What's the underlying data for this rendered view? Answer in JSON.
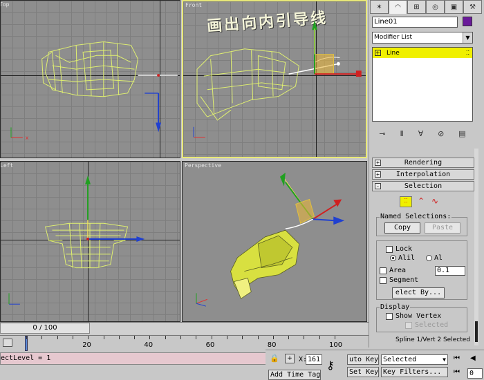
{
  "viewports": {
    "top": {
      "label": "Top"
    },
    "front": {
      "label": "Front",
      "annotation": "画出向内引导线"
    },
    "left": {
      "label": "Left"
    },
    "perspective": {
      "label": "Perspective"
    }
  },
  "panel": {
    "object_name": "Line01",
    "object_color": "#6a1a9a",
    "modifier_list": "Modifier List",
    "stack_item": "Line",
    "rollouts": {
      "rendering": "Rendering",
      "interpolation": "Interpolation",
      "selection": "Selection"
    },
    "named_selections": {
      "title": "Named Selections:",
      "copy": "Copy",
      "paste": "Paste"
    },
    "lock": "Lock",
    "all_label": "Alil",
    "al_label": "Al",
    "area": "Area",
    "area_value": "0.1",
    "segment": "Segment",
    "select_by": "elect By...",
    "display": {
      "title": "Display",
      "show_vertex": "Show Vertex",
      "selected": "Selected"
    },
    "status": "Spline 1/Vert 2 Selected"
  },
  "timeline": {
    "slider": "0 / 100",
    "ticks": [
      "0",
      "20",
      "40",
      "60",
      "80",
      "100"
    ]
  },
  "status_bar": {
    "script_line": "ectLevel = 1",
    "x_label": "X:",
    "x_value": "161",
    "auto_key": "uto Key",
    "set_key": "Set Key",
    "key_mode": "Selected",
    "key_filters": "Key Filters...",
    "add_time_tag": "Add Time Tag",
    "frame_value": "0"
  },
  "colors": {
    "accent_yellow": "#f0f000",
    "viewport_bg": "#8e8e8e",
    "mesh": "#e0f070"
  }
}
